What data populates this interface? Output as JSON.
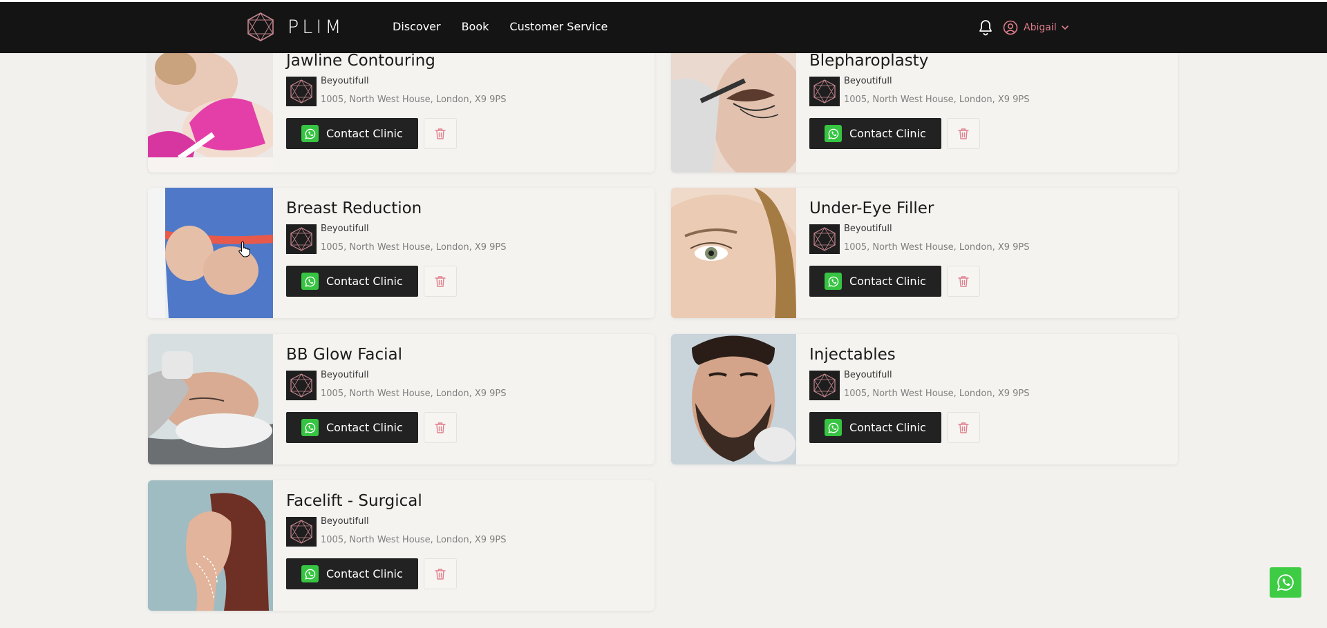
{
  "header": {
    "brand": "PLIM",
    "nav": [
      {
        "label": "Discover"
      },
      {
        "label": "Book"
      },
      {
        "label": "Customer Service"
      }
    ],
    "user_name": "Abigail",
    "colors": {
      "bar": "#141414",
      "accent": "#e07f8d"
    }
  },
  "treatments": [
    {
      "title": "Jawline Contouring",
      "clinic": "Beyoutifull",
      "address": "1005, North West House, London, X9 9PS",
      "button": "Contact Clinic",
      "image": "jawline-photo"
    },
    {
      "title": "Blepharoplasty",
      "clinic": "Beyoutifull",
      "address": "1005, North West House, London, X9 9PS",
      "button": "Contact Clinic",
      "image": "eye-marking-photo"
    },
    {
      "title": "Breast Reduction",
      "clinic": "Beyoutifull",
      "address": "1005, North West House, London, X9 9PS",
      "button": "Contact Clinic",
      "image": "measuring-tape-photo"
    },
    {
      "title": "Under-Eye Filler",
      "clinic": "Beyoutifull",
      "address": "1005, North West House, London, X9 9PS",
      "button": "Contact Clinic",
      "image": "eye-closeup-photo"
    },
    {
      "title": "BB Glow Facial",
      "clinic": "Beyoutifull",
      "address": "1005, North West House, London, X9 9PS",
      "button": "Contact Clinic",
      "image": "facial-treatment-photo"
    },
    {
      "title": "Injectables",
      "clinic": "Beyoutifull",
      "address": "1005, North West House, London, X9 9PS",
      "button": "Contact Clinic",
      "image": "bearded-man-injection-photo"
    },
    {
      "title": "Facelift - Surgical",
      "clinic": "Beyoutifull",
      "address": "1005, North West House, London, X9 9PS",
      "button": "Contact Clinic",
      "image": "facelift-profile-photo"
    }
  ],
  "icons": {
    "whatsapp": "whatsapp-icon",
    "delete": "trash-icon",
    "notification": "bell-icon",
    "user": "user-circle-icon"
  },
  "colors": {
    "whatsapp_green": "#37c442",
    "button_dark": "#222222",
    "delete_red": "#e07f8d",
    "page_bg": "#f2f1ee"
  }
}
